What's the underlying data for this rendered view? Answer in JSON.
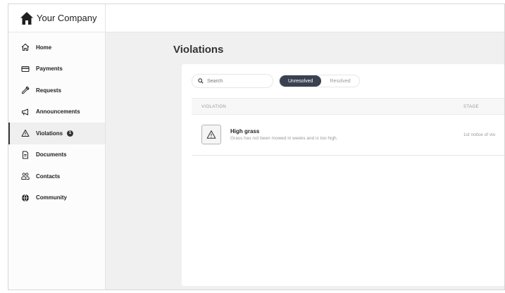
{
  "brand": {
    "name": "Your Company",
    "icon": "house-icon"
  },
  "sidebar": {
    "items": [
      {
        "label": "Home",
        "icon": "home-icon"
      },
      {
        "label": "Payments",
        "icon": "credit-card-icon"
      },
      {
        "label": "Requests",
        "icon": "wrench-icon"
      },
      {
        "label": "Announcements",
        "icon": "megaphone-icon"
      },
      {
        "label": "Violations",
        "icon": "warning-triangle-icon",
        "active": true,
        "badge": "1"
      },
      {
        "label": "Documents",
        "icon": "document-icon"
      },
      {
        "label": "Contacts",
        "icon": "people-icon"
      },
      {
        "label": "Community",
        "icon": "globe-icon"
      }
    ]
  },
  "main": {
    "title": "Violations",
    "search": {
      "placeholder": "Search",
      "value": ""
    },
    "tabs": [
      {
        "label": "Unresolved",
        "selected": true
      },
      {
        "label": "Resolved",
        "selected": false
      }
    ],
    "table": {
      "columns": [
        "VIOLATION",
        "STAGE"
      ],
      "rows": [
        {
          "icon": "warning-triangle-icon",
          "title": "High grass",
          "description": "Grass has not been mowed in weeks and is too high.",
          "stage": "1st notice of vio"
        }
      ]
    }
  },
  "colors": {
    "accent": "#3a4150",
    "sidebar_active": "#efefef",
    "background": "#f0f0f0"
  }
}
